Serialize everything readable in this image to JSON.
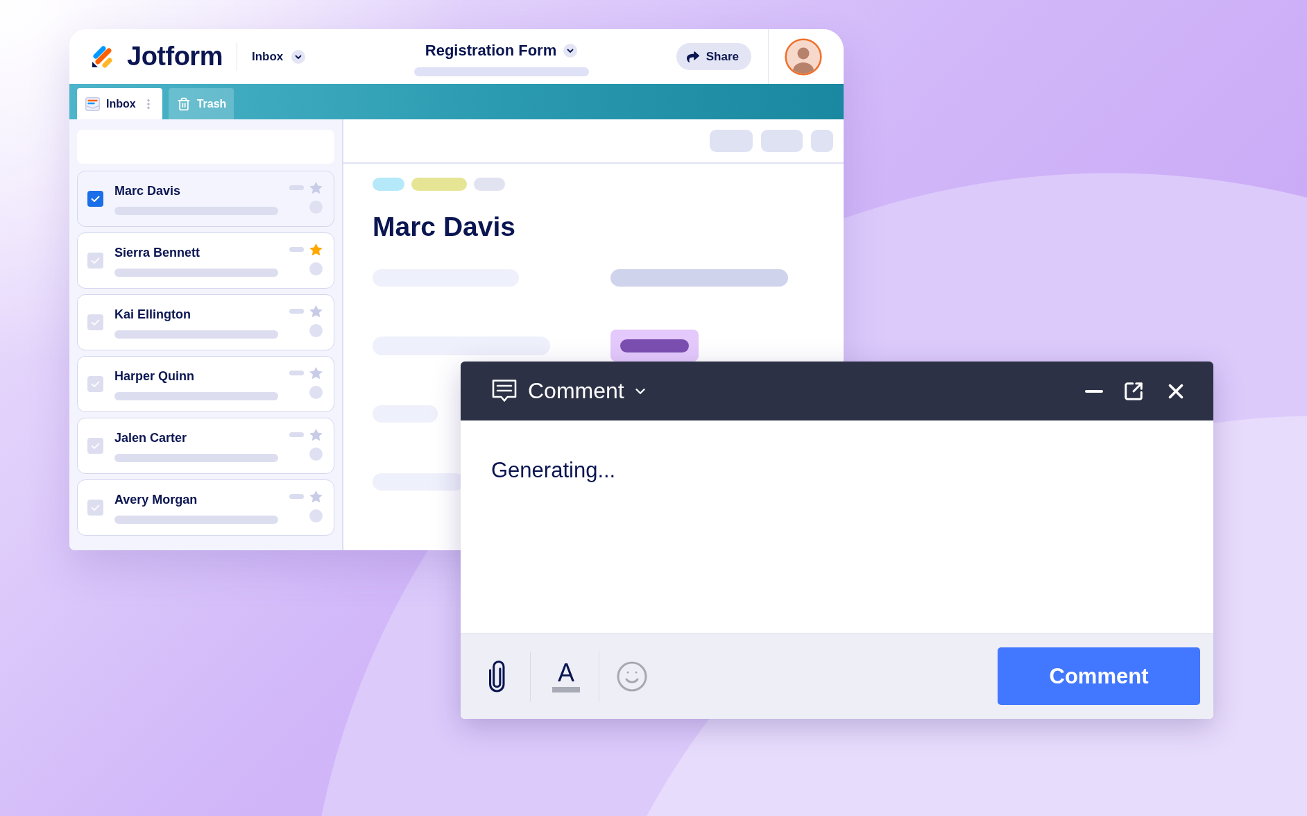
{
  "header": {
    "logo": "Jotform",
    "view_menu": "Inbox",
    "form_title": "Registration Form",
    "share_button": "Share"
  },
  "tabs": [
    {
      "kind": "inbox",
      "label": "Inbox",
      "selected": true
    },
    {
      "kind": "trash",
      "label": "Trash",
      "selected": false
    }
  ],
  "submissions": [
    {
      "name": "Marc Davis",
      "selected": true,
      "checked": true,
      "starred": false
    },
    {
      "name": "Sierra Bennett",
      "selected": false,
      "checked": false,
      "starred": true
    },
    {
      "name": "Kai Ellington",
      "selected": false,
      "checked": false,
      "starred": false
    },
    {
      "name": "Harper Quinn",
      "selected": false,
      "checked": false,
      "starred": false
    },
    {
      "name": "Jalen Carter",
      "selected": false,
      "checked": false,
      "starred": false
    },
    {
      "name": "Avery Morgan",
      "selected": false,
      "checked": false,
      "starred": false
    }
  ],
  "detail": {
    "tags": [
      {
        "color": "#b5e9f9"
      },
      {
        "color": "#e6e596"
      },
      {
        "color": "#e1e3f1"
      }
    ],
    "title": "Marc Davis"
  },
  "comment_panel": {
    "title": "Comment",
    "field": {
      "value": "Generating..."
    },
    "format_button": "A",
    "submit_button": "Comment"
  }
}
